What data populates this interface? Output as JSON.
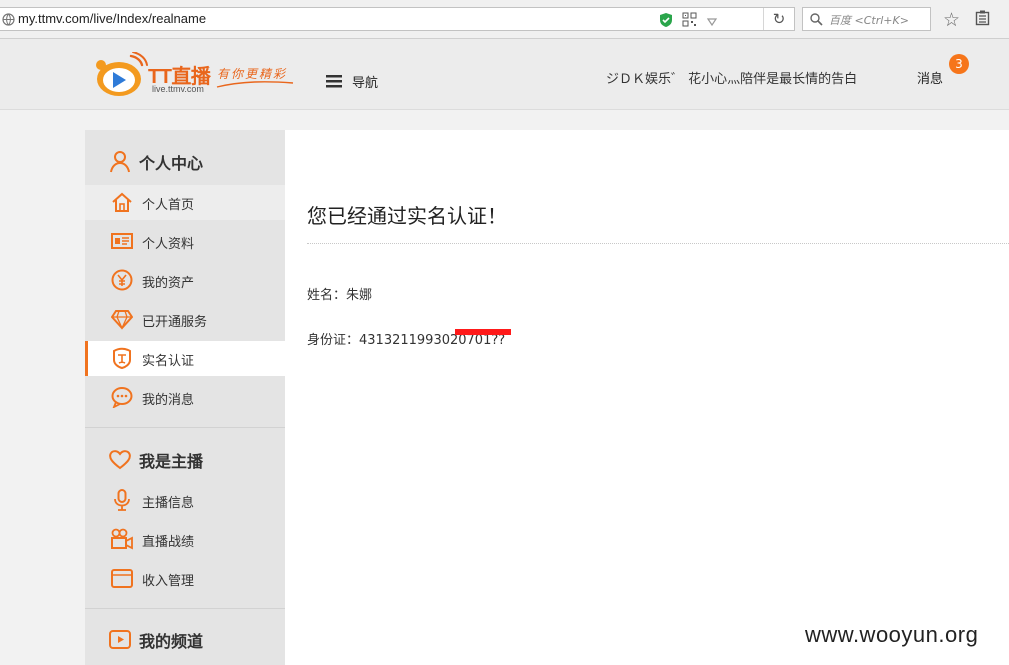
{
  "browser": {
    "url": "my.ttmv.com/live/Index/realname",
    "search_placeholder": "百度 <Ctrl+K>"
  },
  "header": {
    "logo_brand": "TT直播",
    "logo_sub": "live.ttmv.com",
    "logo_slogan": "有你更精彩",
    "nav_label": "导航",
    "user_greeting": "ジＤＫ娱乐゛ 花小心灬陪伴是最长情的告白",
    "messages_label": "消息",
    "messages_count": "3"
  },
  "sidebar": {
    "sections": [
      {
        "title": "个人中心",
        "icon": "person-icon",
        "items": [
          {
            "label": "个人首页",
            "icon": "home-icon"
          },
          {
            "label": "个人资料",
            "icon": "profile-card-icon"
          },
          {
            "label": "我的资产",
            "icon": "yen-coin-icon"
          },
          {
            "label": "已开通服务",
            "icon": "diamond-icon"
          },
          {
            "label": "实名认证",
            "icon": "id-verify-icon",
            "active": true
          },
          {
            "label": "我的消息",
            "icon": "chat-bubble-icon"
          }
        ]
      },
      {
        "title": "我是主播",
        "icon": "heart-icon",
        "items": [
          {
            "label": "主播信息",
            "icon": "microphone-icon"
          },
          {
            "label": "直播战绩",
            "icon": "video-camera-icon"
          },
          {
            "label": "收入管理",
            "icon": "wallet-icon"
          }
        ]
      },
      {
        "title": "我的频道",
        "icon": "play-channel-icon",
        "items": []
      }
    ]
  },
  "main": {
    "title": "您已经通过实名认证！",
    "name_label": "姓名：",
    "name_value": "朱娜",
    "id_label": "身份证：",
    "id_value": "4313211993020701??"
  },
  "watermark": "www.wooyun.org",
  "colors": {
    "accent": "#f0731f",
    "badge": "#f6751a",
    "redaction": "#ff1a1a"
  }
}
